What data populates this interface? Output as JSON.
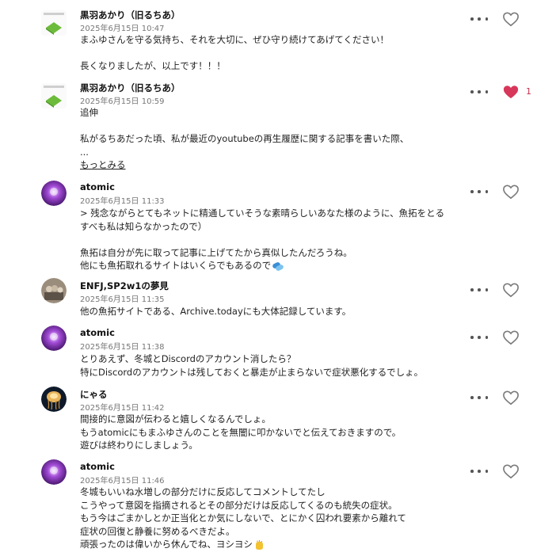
{
  "comments": [
    {
      "author": "黒羽あかり（旧るちあ）",
      "date": "2025年6月15日 10:47",
      "lines": [
        "まふゆさんを守る気持ち、それを大切に、ぜひ守り続けてあげてください！",
        "",
        "長くなりましたが、以上です！！！"
      ],
      "avatar": "logo-avatar",
      "liked": false
    },
    {
      "author": "黒羽あかり（旧るちあ）",
      "date": "2025年6月15日 10:59",
      "lines": [
        "追伸",
        "",
        "私がるちあだった頃、私が最近のyoutubeの再生履歴に関する記事を書いた際、",
        "..."
      ],
      "more_link": "もっとみる",
      "like_count": "1",
      "avatar": "logo-avatar",
      "liked": true
    },
    {
      "author": "atomic",
      "date": "2025年6月15日 11:33",
      "lines": [
        "> 残念ながらとてもネットに精通していそうな素晴らしいあなた様のように、魚拓をとる",
        "すべも私は知らなかったので）",
        "",
        "魚拓は自分が先に取って記事に上げてたから真似したんだろうね。",
        "他にも魚拓取れるサイトはいくらでもあるので"
      ],
      "trailing_icon": "pill-emoji-icon",
      "avatar": "purple-avatar",
      "liked": false
    },
    {
      "author": "ENFJ,SP2w1の夢見",
      "date": "2025年6月15日 11:35",
      "lines": [
        "他の魚拓サイトである、Archive.todayにも大体記録しています。"
      ],
      "avatar": "photo-avatar",
      "liked": false
    },
    {
      "author": "atomic",
      "date": "2025年6月15日 11:38",
      "lines": [
        "とりあえず、冬城とDiscordのアカウント消したら？",
        "特にDiscordのアカウントは残しておくと暴走が止まらないで症状悪化するでしょ。"
      ],
      "avatar": "purple-avatar",
      "liked": false
    },
    {
      "author": "にゃる",
      "date": "2025年6月15日 11:42",
      "lines": [
        "間接的に意図が伝わると嬉しくなるんでしょ。",
        "もうatomicにもまふゆさんのことを無闇に叩かないでと伝えておきますので。",
        "遊びは終わりにしましょう。"
      ],
      "avatar": "jellyfish-avatar",
      "liked": false
    },
    {
      "author": "atomic",
      "date": "2025年6月15日 11:46",
      "lines": [
        "冬城もいいね水増しの部分だけに反応してコメントしてたし",
        "こうやって意図を指摘されるとその部分だけは反応してくるのも統失の症状。",
        "もう今はごまかしとか正当化とか気にしないで、とにかく囚われ要素から離れて",
        "症状の回復と静養に努めるべきだよ。",
        "頑張ったのは偉いから休んでね、ヨシヨシ"
      ],
      "trailing_icon": "clapping-hand-emoji-icon",
      "avatar": "purple-avatar",
      "liked": false
    }
  ],
  "colors": {
    "heart_filled": "#d7375a",
    "heart_outline": "#7a7a7a",
    "text": "#222222",
    "meta": "#777777"
  }
}
